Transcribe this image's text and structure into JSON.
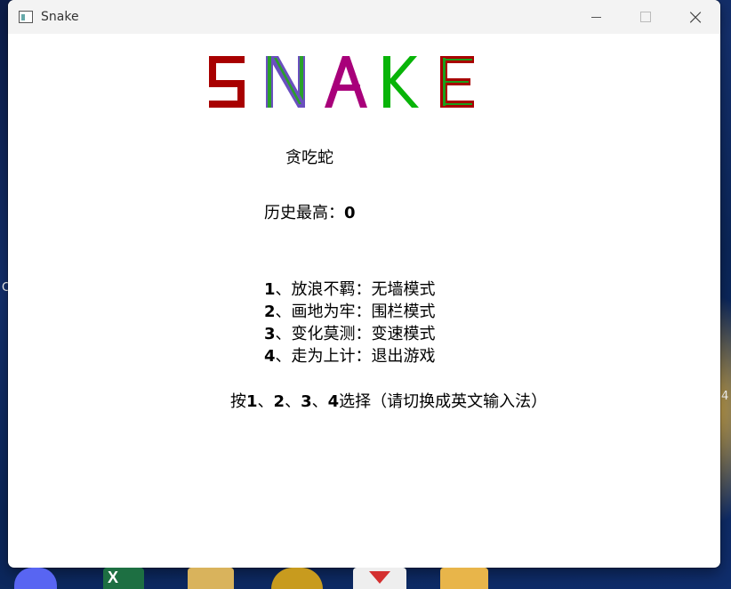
{
  "window": {
    "title": "Snake",
    "controls": {
      "minimize": "minimize",
      "maximize": "maximize",
      "close": "×"
    }
  },
  "game": {
    "logo_text": "SNAKE",
    "logo_colors": {
      "S": {
        "primary": "#a80000",
        "secondary": "#a80000"
      },
      "N1": {
        "primary": "#6a4fbf",
        "secondary": "#2aa02a"
      },
      "N2": {
        "primary": "#12a812",
        "secondary": "#12a812"
      },
      "A": {
        "primary": "#a8007a",
        "secondary": "#a8007a"
      },
      "K": {
        "primary": "#08b408",
        "secondary": "#08b408"
      },
      "E": {
        "primary": "#a80000",
        "secondary": "#1aa01a"
      }
    },
    "subtitle": "贪吃蛇",
    "high_score_label": "历史最高：",
    "high_score_value": "0",
    "menu": [
      {
        "num": "1",
        "text": "、放浪不羁：无墙模式"
      },
      {
        "num": "2",
        "text": "、画地为牢：围栏模式"
      },
      {
        "num": "3",
        "text": "、变化莫测：变速模式"
      },
      {
        "num": "4",
        "text": "、走为上计：退出游戏"
      }
    ],
    "prompt_parts": [
      "按",
      "1",
      "、",
      "2",
      "、",
      "3",
      "、",
      "4",
      "选择（请切换成英文输入法）"
    ]
  },
  "desktop": {
    "left_edge_char": "C",
    "right_edge_char": "4",
    "taskbar_icons": [
      "discord-icon",
      "excel-icon",
      "archive-icon",
      "app-icon",
      "pdf-icon",
      "folder-icon"
    ],
    "taskbar_letter_excel": "X"
  }
}
